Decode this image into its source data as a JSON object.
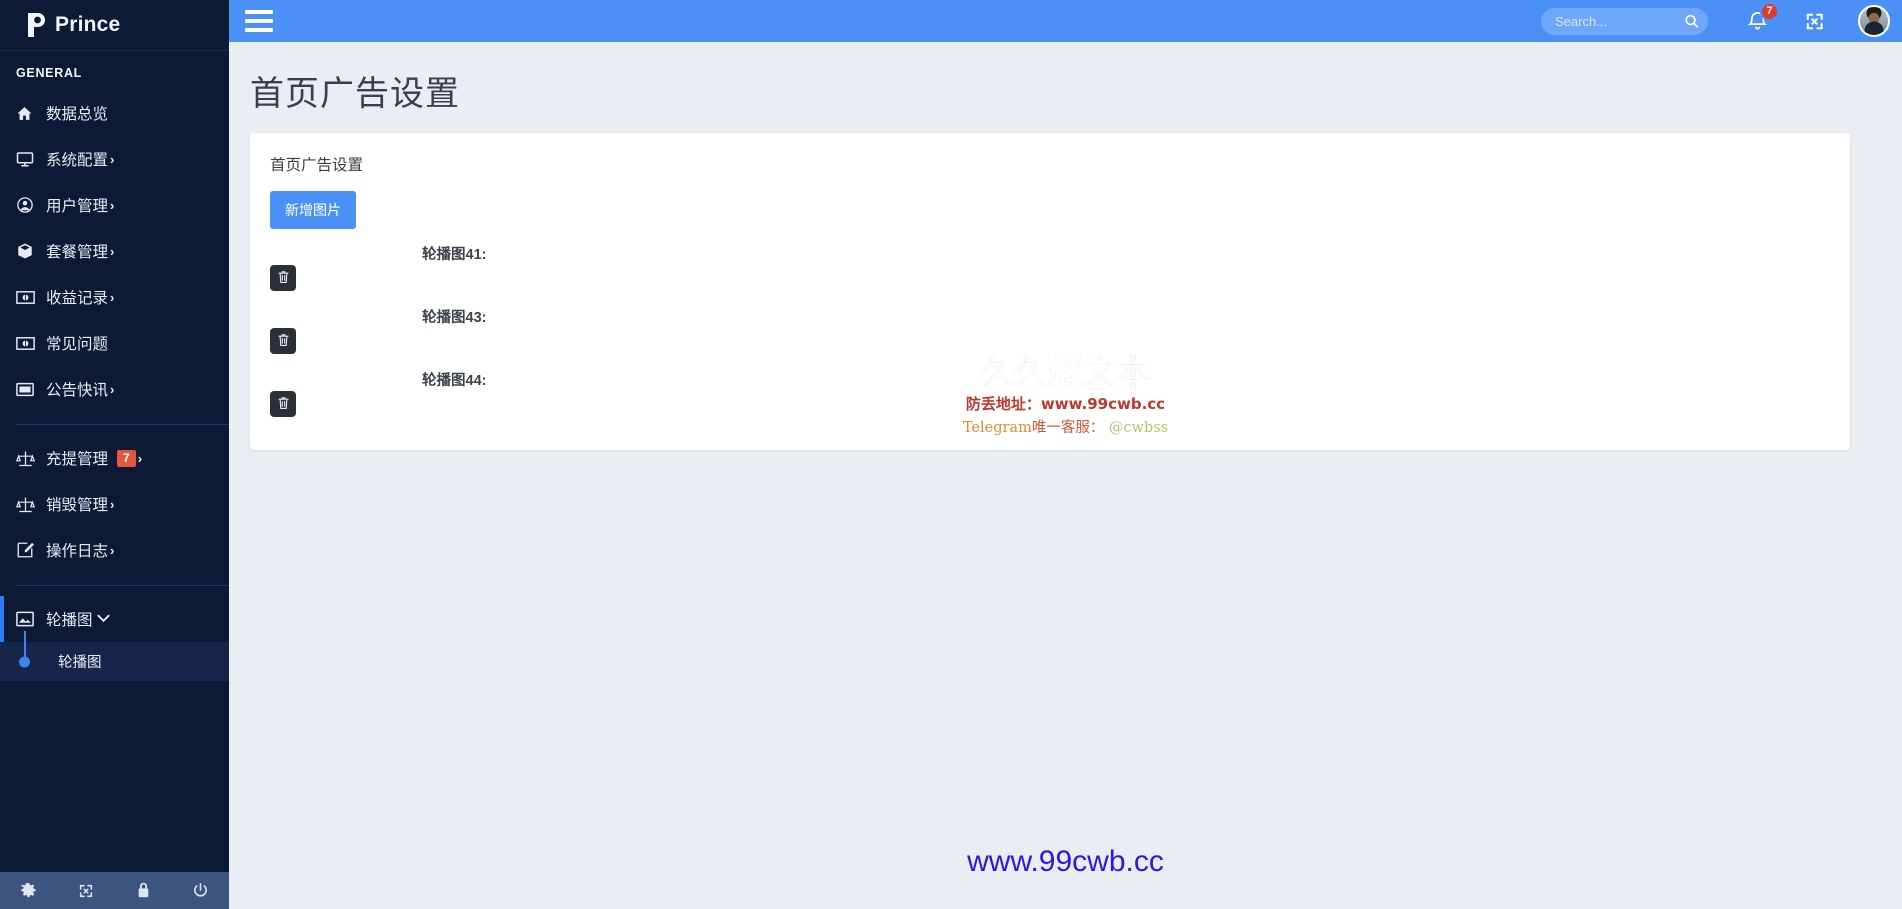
{
  "brand": {
    "logo_icon": "p-logo-icon",
    "name": "Prince"
  },
  "sidebar": {
    "section_title": "GENERAL",
    "items": [
      {
        "label": "数据总览",
        "icon": "home-icon",
        "caret": "",
        "badge": ""
      },
      {
        "label": "系统配置",
        "icon": "monitor-icon",
        "caret": "›",
        "badge": ""
      },
      {
        "label": "用户管理",
        "icon": "user-circle-icon",
        "caret": "›",
        "badge": ""
      },
      {
        "label": "套餐管理",
        "icon": "box-icon",
        "caret": "›",
        "badge": ""
      },
      {
        "label": "收益记录",
        "icon": "money-icon",
        "caret": "›",
        "badge": ""
      },
      {
        "label": "常见问题",
        "icon": "money-icon",
        "caret": "",
        "badge": ""
      },
      {
        "label": "公告快讯",
        "icon": "window-icon",
        "caret": "›",
        "badge": ""
      }
    ],
    "items2": [
      {
        "label": "充提管理",
        "icon": "scales-icon",
        "caret": "›",
        "badge": "7"
      },
      {
        "label": "销毁管理",
        "icon": "scales-icon",
        "caret": "›",
        "badge": ""
      },
      {
        "label": "操作日志",
        "icon": "edit-icon",
        "caret": "›",
        "badge": ""
      }
    ],
    "active_parent": {
      "label": "轮播图",
      "icon": "image-icon",
      "caret": "⌄"
    },
    "active_child": {
      "label": "轮播图"
    },
    "footer_icons": [
      "gear-icon",
      "expand-icon",
      "lock-icon",
      "power-icon"
    ]
  },
  "topbar": {
    "menu_icon": "hamburger-icon",
    "search": {
      "value": "",
      "placeholder": "Search...",
      "icon": "search-icon"
    },
    "notifications": {
      "icon": "bell-icon",
      "count": "7"
    },
    "fullscreen_icon": "expand-arrows-icon",
    "avatar": "user-avatar"
  },
  "page": {
    "title": "首页广告设置",
    "card_heading": "首页广告设置",
    "add_button": "新增图片",
    "slides": [
      {
        "label": "轮播图41:",
        "delete_icon": "trash-icon"
      },
      {
        "label": "轮播图43:",
        "delete_icon": "trash-icon"
      },
      {
        "label": "轮播图44:",
        "delete_icon": "trash-icon"
      }
    ]
  },
  "watermark": {
    "title": "久久超文本",
    "line2": "防丢地址：www.99cwb.cc",
    "telegram_prefix": "Telegram",
    "telegram_label": "唯一客服：",
    "telegram_handle": "@cwbss"
  },
  "footer": {
    "url": "www.99cwb.cc"
  },
  "colors": {
    "sidebar_bg": "#0c1a35",
    "topbar_bg": "#4a90f7",
    "accent": "#2f7bf6",
    "badge": "#e4573d",
    "page_bg": "#eaeef3"
  }
}
